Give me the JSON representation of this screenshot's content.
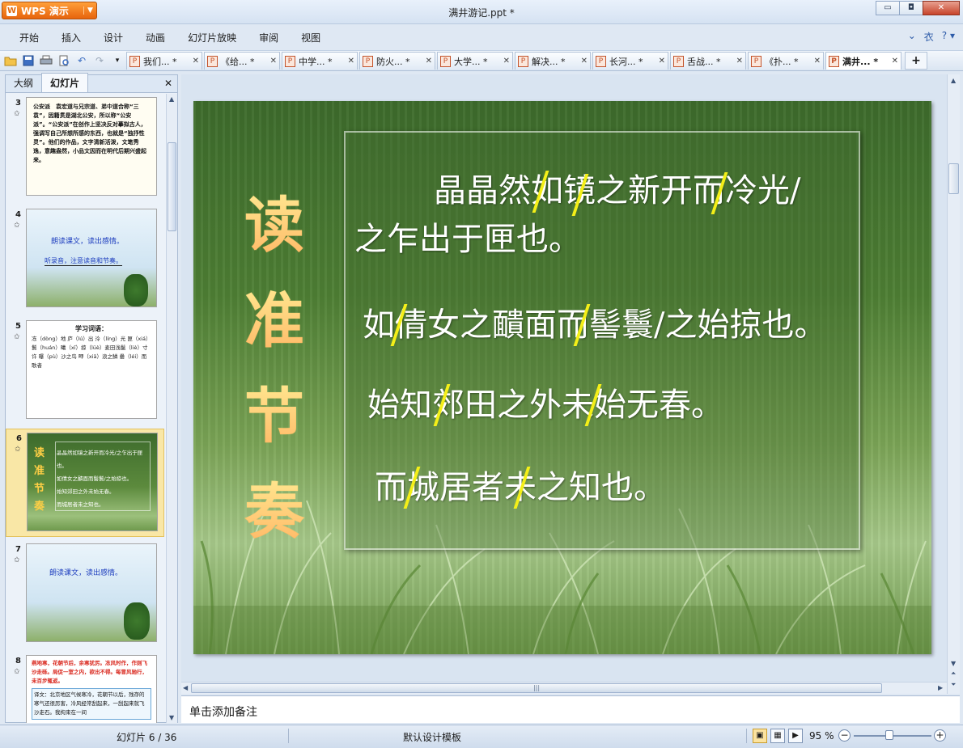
{
  "app": {
    "name": "WPS 演示",
    "document_title": "满井游记.ppt *"
  },
  "window_controls": {
    "minimize": "▭",
    "restore": "◘",
    "close": "✕"
  },
  "menu": [
    "开始",
    "插入",
    "设计",
    "动画",
    "幻灯片放映",
    "审阅",
    "视图"
  ],
  "menu_right": {
    "collapse": "⌄",
    "skin": "衣",
    "help": "? ▾"
  },
  "toolbar_icons": [
    "open-icon",
    "save-icon",
    "print-icon",
    "print-preview-icon",
    "undo-icon",
    "redo-icon",
    "more-icon"
  ],
  "doc_tabs": [
    {
      "label": "我们... *",
      "active": false
    },
    {
      "label": "《给... *",
      "active": false
    },
    {
      "label": "中学... *",
      "active": false
    },
    {
      "label": "防火... *",
      "active": false
    },
    {
      "label": "大学... *",
      "active": false
    },
    {
      "label": "解决... *",
      "active": false
    },
    {
      "label": "长河... *",
      "active": false
    },
    {
      "label": "舌战... *",
      "active": false
    },
    {
      "label": "《扑... *",
      "active": false
    },
    {
      "label": "满井... *",
      "active": true
    }
  ],
  "panel": {
    "tab_outline": "大纲",
    "tab_slides": "幻灯片",
    "close": "✕"
  },
  "thumbnails": [
    {
      "num": "3",
      "text": "公安派　袁宏道与兄宗道、弟中道合称“三袁”，因籍贯是湖北公安，所以称“公安派”。“公安派”在创作上坚决反对摹拟古人，强调写自己所想所感的东西，也就是“独抒性灵”。他们的作品，文字清新活泼，文笔秀逸，意趣盎然，小品文因而在明代后期兴盛起来。"
    },
    {
      "num": "4",
      "line1": "朗读课文，读出感情。",
      "line2": "听录音，注意读音和节奏。"
    },
    {
      "num": "5",
      "title": "学习词语：",
      "text": "冻（dòng）地 庐（lú）出 泠（líng）光 匣（xiá）鬟（huán）曦（xī）掠（lüè）麦田浅鬣（liè）寸许 曝（pù）沙之鸟 呷（xiā）浪之鳞 罍（léi）而歌者"
    },
    {
      "num": "6",
      "lines": [
        "晶晶然如镜之新开而冷光/之乍出于匣也。",
        "如倩女之靧面而髻鬟/之始掠也。",
        "始知郊田之外未始无春。",
        "而城居者未之知也。"
      ],
      "title": "读准节奏"
    },
    {
      "num": "7",
      "line1": "朗读课文，读出感情。"
    },
    {
      "num": "8",
      "text": "燕地寒，花朝节后，余寒犹厉。冻风时作，作则飞沙走砾。局促一室之内，欲出不得。每冒风驰行，未百步辄返。",
      "note": "译文：北京地区气候寒冷，花朝节以后，残存的寒气还很厉害，冷风经常刮起来，一刮起来就飞沙走石。我拘束在一间"
    }
  ],
  "slide": {
    "vertical_title": [
      "读",
      "准",
      "节",
      "奏"
    ],
    "lines": [
      "晶晶然如镜之新开而冷光/",
      "之乍出于匣也。",
      "如倩女之靧面而髻鬟/之始掠也。",
      "始知郊田之外未始无春。",
      "而城居者未之知也。"
    ]
  },
  "notes_placeholder": "单击添加备注",
  "status": {
    "slide_indicator": "幻灯片 6 / 36",
    "template": "默认设计模板",
    "zoom": "95 %"
  },
  "colors": {
    "accent_orange": "#e7640c",
    "rhythm_mark": "#f4ef18",
    "title_gold": "#ffd44b"
  }
}
